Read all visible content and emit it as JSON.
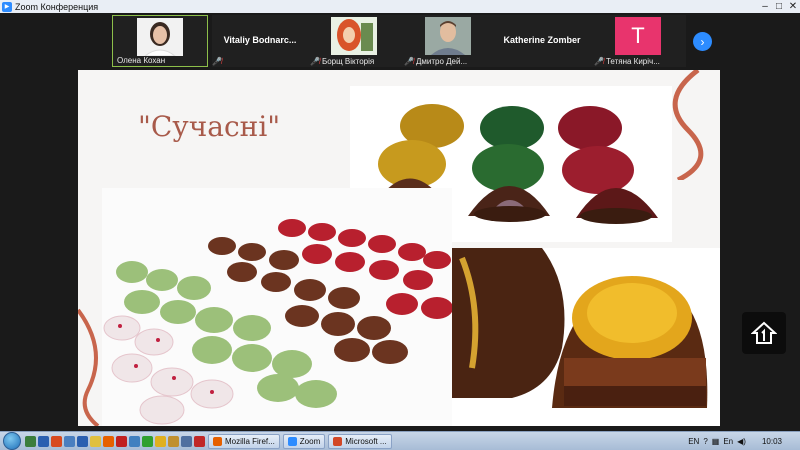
{
  "window": {
    "title": "Zoom Конференция",
    "controls": [
      "–",
      "□",
      "✕"
    ]
  },
  "participants": [
    {
      "name": "Олена Кохан",
      "type": "photo",
      "muted": false,
      "active": true
    },
    {
      "name": "Vitaliy   Bodnarc...",
      "type": "name-only",
      "muted": true,
      "active": false
    },
    {
      "name": "Борщ Вікторія",
      "type": "photo",
      "muted": true,
      "active": false
    },
    {
      "name": "Дмитро Дей...",
      "type": "photo",
      "muted": true,
      "active": false
    },
    {
      "name": "Katherine Zomber",
      "type": "name-only",
      "muted": false,
      "active": false
    },
    {
      "name": "Тетяна Киріч...",
      "type": "letter",
      "letter": "T",
      "muted": true,
      "active": false
    }
  ],
  "strip_next_icon": "chevron-right-icon",
  "slide": {
    "title": "\"Сучасні\""
  },
  "share_icon": "share-screen-icon",
  "taskbar": {
    "tasks": [
      {
        "label": "Mozilla Firef...",
        "icon": "firefox-icon",
        "color": "#e66000"
      },
      {
        "label": "Zoom",
        "icon": "zoom-icon",
        "color": "#2d8cff"
      },
      {
        "label": "Microsoft ...",
        "icon": "powerpoint-icon",
        "color": "#d24726"
      }
    ],
    "tray": {
      "lang1": "EN",
      "lang2": "En",
      "time": "10:03"
    }
  }
}
